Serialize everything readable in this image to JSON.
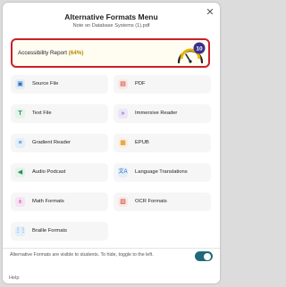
{
  "dialog": {
    "title": "Alternative Formats Menu",
    "subtitle": "Note on Database Systems (1).pdf",
    "close_icon": "close-icon"
  },
  "report": {
    "label": "Accessibility Report",
    "percent": "(64%)",
    "score": "10",
    "gauge_icon": "gauge-icon",
    "accent": "#c8202a"
  },
  "formats": [
    {
      "label": "Source File",
      "icon": "file-icon",
      "color": "#2b6cb0",
      "bg": "#e3eefb"
    },
    {
      "label": "PDF",
      "icon": "pdf-icon",
      "color": "#c0392b",
      "bg": "#fbe6e3"
    },
    {
      "label": "Text File",
      "icon": "text-icon",
      "color": "#2e8b57",
      "bg": "#e3f4ea"
    },
    {
      "label": "Immersive Reader",
      "icon": "immersive-reader-icon",
      "color": "#6c3fb5",
      "bg": "#ece5f8"
    },
    {
      "label": "Gradient Reader",
      "icon": "gradient-reader-icon",
      "color": "#2b6cb0",
      "bg": "#e3eefb"
    },
    {
      "label": "EPUB",
      "icon": "epub-icon",
      "color": "#d4820e",
      "bg": "#fcefdc"
    },
    {
      "label": "Audio Podcast",
      "icon": "speaker-icon",
      "color": "#2e8b57",
      "bg": "#e3f4ea"
    },
    {
      "label": "Language Translations",
      "icon": "translate-icon",
      "color": "#2b6cb0",
      "bg": "#e3eefb"
    },
    {
      "label": "Math Formats",
      "icon": "math-icon",
      "color": "#b03a9a",
      "bg": "#f7e3f3"
    },
    {
      "label": "OCR Formats",
      "icon": "ocr-icon",
      "color": "#c0392b",
      "bg": "#fbe6e3"
    },
    {
      "label": "Braille Formats",
      "icon": "braille-icon",
      "color": "#2b6cb0",
      "bg": "#e3eefb"
    }
  ],
  "footer": {
    "text": "Alternative Formats are visible to students. To hide, toggle to the left.",
    "toggle_on": true,
    "toggle_color": "#1e6a78",
    "help_label": "Help"
  }
}
